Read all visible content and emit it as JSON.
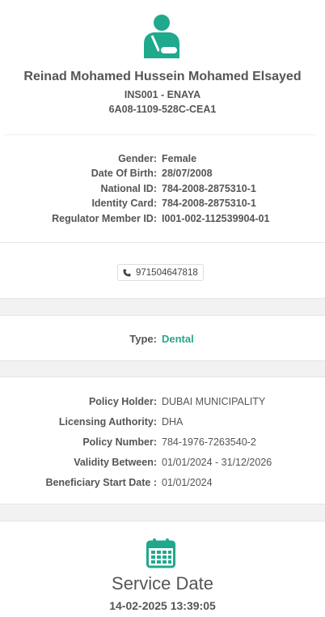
{
  "header": {
    "patient_name": "Reinad Mohamed Hussein Mohamed Elsayed",
    "insurer": "INS001 - ENAYA",
    "code": "6A08-1109-528C-CEA1"
  },
  "identity": {
    "gender_label": "Gender:",
    "gender": "Female",
    "dob_label": "Date Of Birth:",
    "dob": "28/07/2008",
    "national_id_label": "National ID:",
    "national_id": "784-2008-2875310-1",
    "identity_card_label": "Identity Card:",
    "identity_card": "784-2008-2875310-1",
    "regulator_label": "Regulator Member ID:",
    "regulator_id": "I001-002-112539904-01"
  },
  "contact": {
    "phone": "971504647818"
  },
  "coverage": {
    "type_label": "Type:",
    "type": "Dental"
  },
  "policy": {
    "holder_label": "Policy Holder:",
    "holder": "DUBAI MUNICIPALITY",
    "authority_label": "Licensing Authority:",
    "authority": "DHA",
    "number_label": "Policy Number:",
    "number": "784-1976-7263540-2",
    "validity_label": "Validity Between:",
    "validity": "01/01/2024 - 31/12/2026",
    "start_label": "Beneficiary Start Date :",
    "start": "01/01/2024"
  },
  "service": {
    "title": "Service Date",
    "datetime": "14-02-2025 13:39:05"
  },
  "colors": {
    "accent": "#2aa58c"
  },
  "icons": {
    "patient": "patient-icon",
    "phone": "phone-icon",
    "calendar": "calendar-icon"
  }
}
